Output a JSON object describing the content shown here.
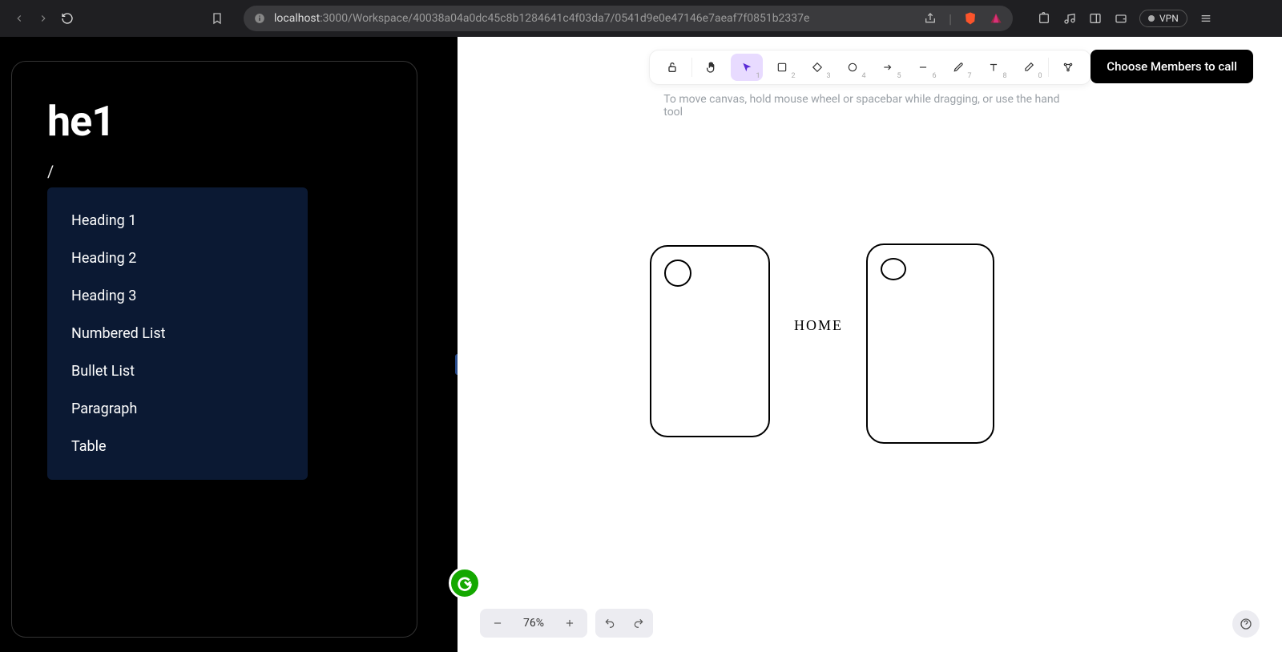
{
  "browser": {
    "url_prefix": "localhost",
    "url_rest": ":3000/Workspace/40038a04a0dc45c8b1284641c4f03da7/0541d9e0e47146e7aeaf7f0851b2337e",
    "vpn_label": "VPN"
  },
  "note": {
    "title": "he1",
    "slash": "/",
    "menu": [
      "Heading 1",
      "Heading 2",
      "Heading 3",
      "Numbered List",
      "Bullet List",
      "Paragraph",
      "Table"
    ]
  },
  "canvas": {
    "hint": "To move canvas, hold mouse wheel or spacebar while dragging, or use the hand tool",
    "cta": "Choose Members to call",
    "home_label": "HOME",
    "tools": {
      "lock": "",
      "hand": "",
      "select_idx": "1",
      "rect_idx": "2",
      "diamond_idx": "3",
      "circle_idx": "4",
      "arrow_idx": "5",
      "line_idx": "6",
      "draw_idx": "7",
      "text_idx": "8",
      "eraser_idx": "0"
    },
    "zoom": {
      "value": "76%"
    }
  }
}
